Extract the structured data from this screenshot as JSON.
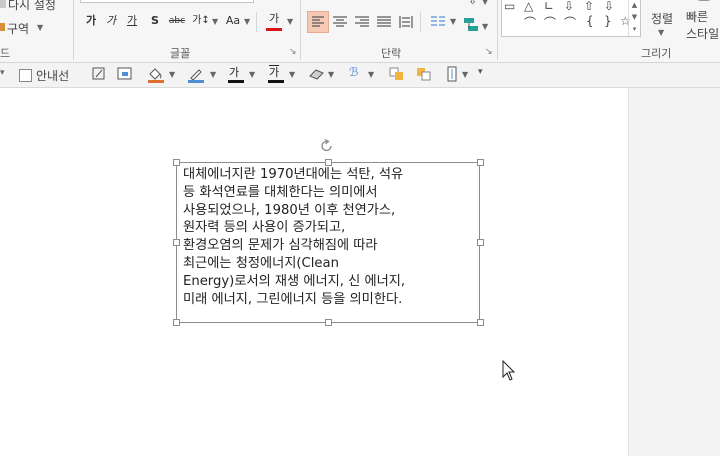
{
  "ribbon": {
    "clipboard_items": [
      "다시 설정",
      "구역"
    ],
    "clipboard_partial_label": "드",
    "font_group_label": "글꼴",
    "paragraph_group_label": "단락",
    "drawing_group_label": "그리기",
    "font_buttons": [
      "가",
      "가",
      "가",
      "S",
      "abc",
      "가↕",
      "Aa",
      "가"
    ],
    "arrange_label": "정렬",
    "quick_styles_label": [
      "빠른",
      "스타일"
    ],
    "shape_symbols": [
      "▭",
      "△",
      "∟",
      "⇩",
      "⇧",
      "⇩",
      "⌒",
      "⌒",
      "⌒",
      "{",
      "}",
      "☆"
    ]
  },
  "toolbar2": {
    "guide_checkbox_label": "안내선",
    "guide_checked": false,
    "font_color_glyph": "가",
    "highlight_glyph": "가"
  },
  "colors": {
    "fill": "#e36c2f",
    "outline": "#4d8fd4",
    "font": "#d6161b",
    "selected_align": "#f5c9b5",
    "shape_teal": "#2aa198"
  },
  "textbox": {
    "lines": [
      "대체에너지란 1970년대에는 석탄, 석유",
      "등 화석연료를 대체한다는 의미에서",
      "사용되었으나, 1980년 이후 천연가스,",
      "원자력 등의 사용이 증가되고,",
      "환경오염의 문제가 심각해짐에 따라",
      "최근에는 청정에너지(Clean",
      "Energy)로서의 재생 에너지, 신 에너지,",
      "미래 에너지, 그린에너지 등을 의미한다."
    ]
  }
}
